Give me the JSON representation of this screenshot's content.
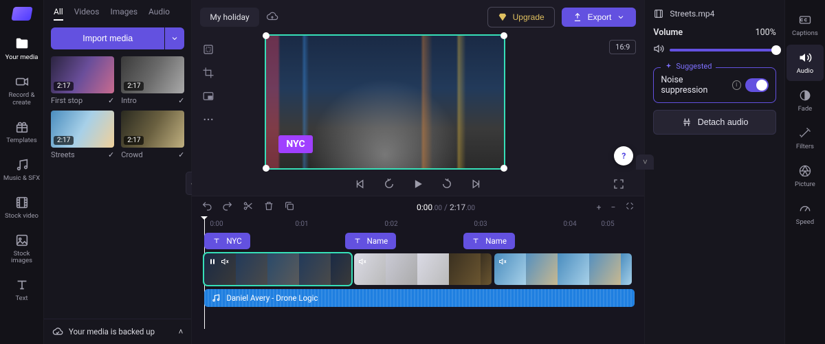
{
  "project": {
    "name": "My holiday"
  },
  "header": {
    "upgrade": "Upgrade",
    "export": "Export"
  },
  "media_tabs": [
    "All",
    "Videos",
    "Images",
    "Audio"
  ],
  "import_label": "Import media",
  "media": [
    {
      "title": "First stop",
      "duration": "2:17"
    },
    {
      "title": "Intro",
      "duration": "2:17"
    },
    {
      "title": "Streets",
      "duration": "2:17"
    },
    {
      "title": "Crowd",
      "duration": "2:17"
    }
  ],
  "backup_message": "Your media is backed up",
  "left_rail": [
    "Your media",
    "Record & create",
    "Templates",
    "Music & SFX",
    "Stock video",
    "Stock images",
    "Text"
  ],
  "right_rail": [
    "Captions",
    "Audio",
    "Fade",
    "Filters",
    "Picture",
    "Speed"
  ],
  "preview": {
    "aspect": "16:9",
    "overlay_tag": "NYC"
  },
  "timeline": {
    "current": "0:00",
    "current_sub": ".00",
    "total": "2:17",
    "total_sub": ".00",
    "ticks": [
      "0:00",
      "0:01",
      "0:02",
      "0:03",
      "0:04",
      "0:05"
    ],
    "text_clips": [
      "NYC",
      "Name",
      "Name"
    ],
    "audio_label": "Daniel Avery - Drone Logic"
  },
  "inspector": {
    "file": "Streets.mp4",
    "volume_label": "Volume",
    "volume_value": "100%",
    "suggested_tag": "Suggested",
    "noise_label": "Noise suppression",
    "detach": "Detach audio"
  }
}
